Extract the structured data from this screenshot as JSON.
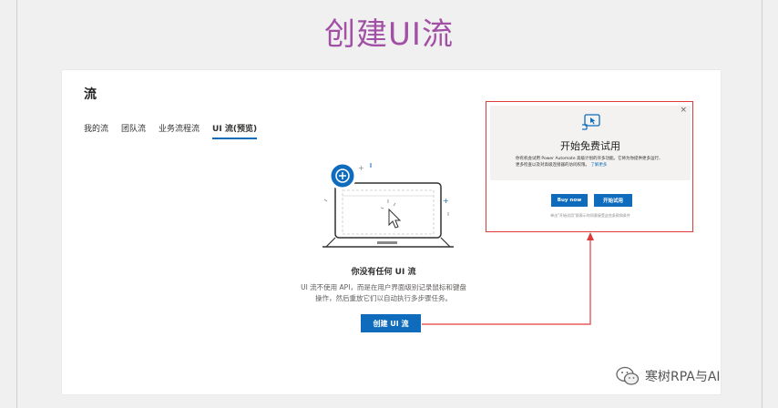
{
  "slide_title": "创建UI流",
  "page": {
    "heading": "流",
    "tabs": [
      {
        "label": "我的流",
        "active": false
      },
      {
        "label": "团队流",
        "active": false
      },
      {
        "label": "业务流程流",
        "active": false
      },
      {
        "label": "UI 流(预览)",
        "active": true
      }
    ]
  },
  "empty_state": {
    "title": "你没有任何 UI 流",
    "description_line1": "UI 流不使用 API，而是在用户界面级别记录鼠标和键盘",
    "description_line2": "操作，然后重放它们以自动执行多步骤任务。",
    "button_label": "创建 UI 流"
  },
  "trial_dialog": {
    "title": "开始免费试用",
    "body": "你有机会试用 Power Automate 高级计划的许多功能。它将为你提供更多运行、更多检查以及对高级连接器的访问权限。",
    "link": "了解更多",
    "buy_label": "Buy now",
    "start_label": "开始试用",
    "note": "单击\"开始试用\"即表示你同意接受这些条款和条件",
    "close_glyph": "×"
  },
  "watermark": {
    "text": "寒树RPA与AI"
  },
  "colors": {
    "accent": "#0f6cbd",
    "title": "#a24fa6",
    "highlight": "#e03b3b"
  }
}
